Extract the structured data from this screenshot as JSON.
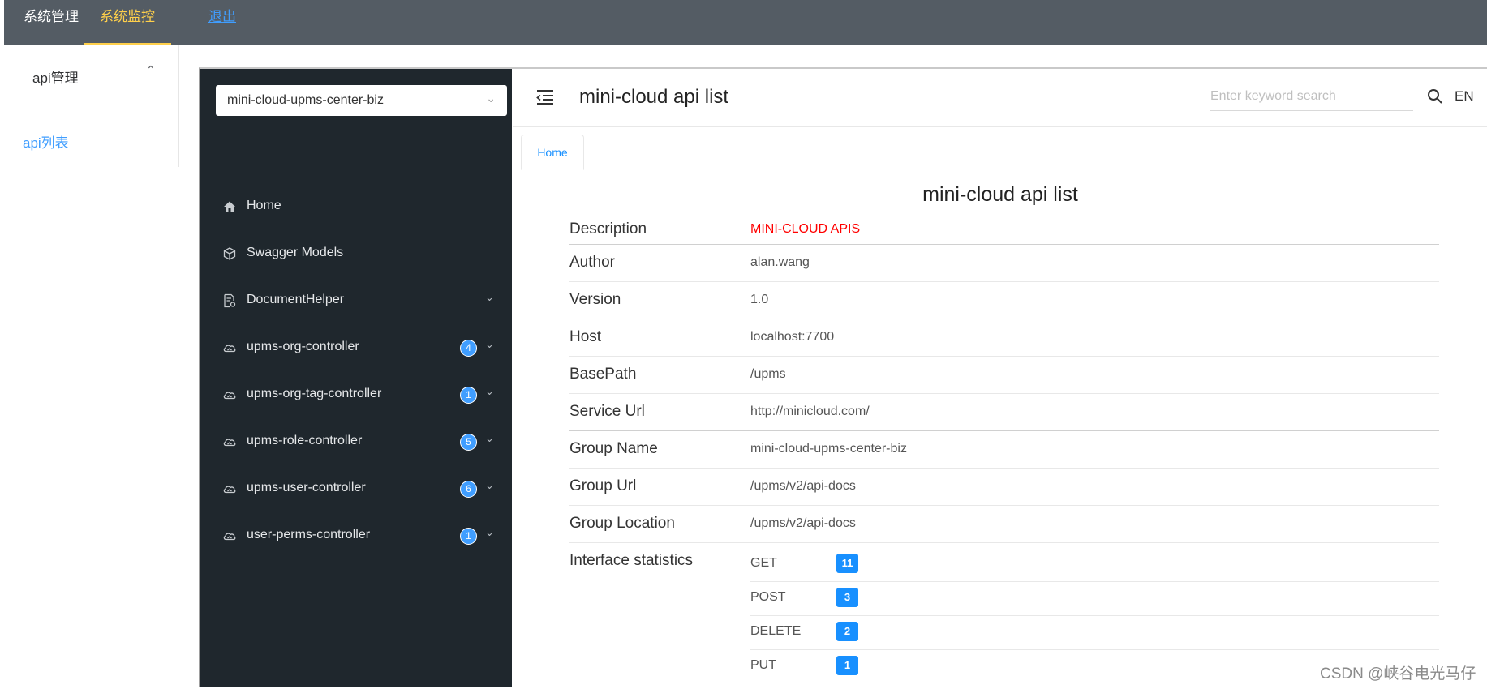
{
  "topnav": {
    "items": [
      {
        "label": "系统管理"
      },
      {
        "label": "系统监控"
      },
      {
        "label": "退出"
      }
    ],
    "colors": {
      "bg": "#545c64",
      "active": "#ffd04b",
      "link": "#409eff"
    }
  },
  "app_sidebar": {
    "group_label": "api管理",
    "sub_item": "api列表"
  },
  "doc_sidebar": {
    "group_select": "mini-cloud-upms-center-biz",
    "items": [
      {
        "label": "Home",
        "icon": "home-icon"
      },
      {
        "label": "Swagger Models",
        "icon": "cube-icon"
      },
      {
        "label": "DocumentHelper",
        "icon": "document-settings-icon"
      },
      {
        "label": "upms-org-controller",
        "icon": "cloud-icon",
        "badge": "4"
      },
      {
        "label": "upms-org-tag-controller",
        "icon": "cloud-icon",
        "badge": "1"
      },
      {
        "label": "upms-role-controller",
        "icon": "cloud-icon",
        "badge": "5"
      },
      {
        "label": "upms-user-controller",
        "icon": "cloud-icon",
        "badge": "6"
      },
      {
        "label": "user-perms-controller",
        "icon": "cloud-icon",
        "badge": "1"
      }
    ]
  },
  "header": {
    "title": "mini-cloud api list",
    "search_placeholder": "Enter keyword search",
    "lang": "EN"
  },
  "tabs": [
    {
      "label": "Home"
    }
  ],
  "doc": {
    "title": "mini-cloud api list",
    "fields": [
      {
        "key": "Description",
        "value": "MINI-CLOUD APIS"
      },
      {
        "key": "Author",
        "value": "alan.wang"
      },
      {
        "key": "Version",
        "value": "1.0"
      },
      {
        "key": "Host",
        "value": "localhost:7700"
      },
      {
        "key": "BasePath",
        "value": "/upms"
      },
      {
        "key": "Service Url",
        "value": "http://minicloud.com/"
      },
      {
        "key": "Group Name",
        "value": "mini-cloud-upms-center-biz"
      },
      {
        "key": "Group Url",
        "value": "/upms/v2/api-docs"
      },
      {
        "key": "Group Location",
        "value": "/upms/v2/api-docs"
      }
    ],
    "stats_label": "Interface statistics",
    "stats": [
      {
        "method": "GET",
        "count": "11"
      },
      {
        "method": "POST",
        "count": "3"
      },
      {
        "method": "DELETE",
        "count": "2"
      },
      {
        "method": "PUT",
        "count": "1"
      }
    ]
  },
  "watermark": "CSDN @峡谷电光马仔"
}
